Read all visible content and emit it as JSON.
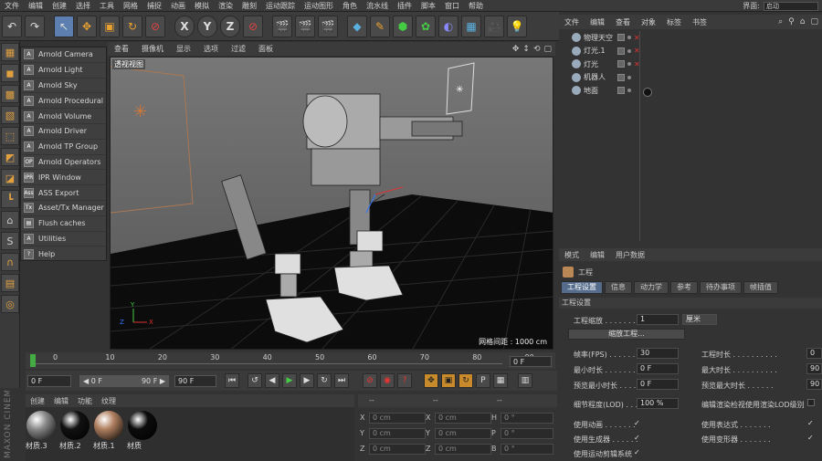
{
  "menu": [
    "文件",
    "编辑",
    "创建",
    "选择",
    "工具",
    "网格",
    "捕捉",
    "动画",
    "模拟",
    "渲染",
    "雕刻",
    "运动跟踪",
    "运动图形",
    "角色",
    "流水线",
    "插件",
    "脚本",
    "窗口",
    "帮助"
  ],
  "layout": {
    "label": "界面:",
    "value": "启动"
  },
  "toolbar": {
    "undo": "↶",
    "redo": "↷",
    "axis_x": "X",
    "axis_y": "Y",
    "axis_z": "Z"
  },
  "arnold_menu": [
    {
      "icon": "A",
      "label": "Arnold Camera"
    },
    {
      "icon": "A",
      "label": "Arnold Light"
    },
    {
      "icon": "A",
      "label": "Arnold Sky"
    },
    {
      "icon": "A",
      "label": "Arnold Procedural"
    },
    {
      "icon": "A",
      "label": "Arnold Volume"
    },
    {
      "icon": "A",
      "label": "Arnold Driver"
    },
    {
      "icon": "A",
      "label": "Arnold TP Group"
    },
    {
      "icon": "OP",
      "label": "Arnold Operators"
    },
    {
      "icon": "IPR",
      "label": "IPR Window"
    },
    {
      "icon": "Ass",
      "label": "ASS Export"
    },
    {
      "icon": "Tx",
      "label": "Asset/Tx Manager"
    },
    {
      "icon": "▤",
      "label": "Flush caches"
    },
    {
      "icon": "A",
      "label": "Utilities"
    },
    {
      "icon": "?",
      "label": "Help"
    }
  ],
  "viewport": {
    "menu": [
      "查看",
      "摄像机",
      "显示",
      "选项",
      "过滤",
      "面板"
    ],
    "label": "透视视图",
    "grid_spacing": "网格间距 : 1000 cm"
  },
  "objects": {
    "menu": [
      "文件",
      "编辑",
      "查看",
      "对象",
      "标签",
      "书签"
    ],
    "items": [
      {
        "name": "物理天空",
        "flag_x": true
      },
      {
        "name": "灯光.1",
        "flag_x": true
      },
      {
        "name": "灯光",
        "flag_x": true
      },
      {
        "name": "机器人",
        "flag_x": false
      },
      {
        "name": "地面",
        "flag_x": false
      }
    ]
  },
  "attributes": {
    "menu": [
      "模式",
      "编辑",
      "用户数据"
    ],
    "title": "工程",
    "tabs": [
      "工程设置",
      "信息",
      "动力学",
      "参考",
      "待办事项",
      "帧插值"
    ],
    "section": "工程设置",
    "scale_label": "工程缩放 . . . . . . . .",
    "scale_value": "1",
    "scale_unit": "厘米",
    "scale_button": "缩放工程...",
    "fps_label": "帧率(FPS) . . . . . . .",
    "fps_value": "30",
    "min_time_label": "最小时长 . . . . . . . .",
    "min_time_value": "0 F",
    "preview_min_label": "预览最小时长 . . . .",
    "preview_min_value": "0 F",
    "lod_label": "细节程度(LOD) . . . .",
    "lod_value": "100 %",
    "proj_time_label": "工程时长 . . . . . . . . . .",
    "proj_time_value": "0",
    "max_time_label": "最大时长 . . . . . . . . . .",
    "max_time_value": "90",
    "preview_max_label": "预览最大时长 . . . . . .",
    "preview_max_value": "90",
    "render_lod_label": "编辑渲染检视使用渲染LOD级别",
    "use_anim": "使用动画 . . . . . . .",
    "use_gen": "使用生成器 . . . . . .",
    "use_motion": "使用运动剪辑系统",
    "use_expr": "使用表达式 . . . . . . .",
    "use_deform": "使用变形器 . . . . . . .",
    "check": "✓"
  },
  "timeline": {
    "ticks": [
      "0",
      "10",
      "20",
      "30",
      "40",
      "50",
      "60",
      "70",
      "80",
      "90"
    ],
    "current_frame": 0,
    "end_field": "0 F"
  },
  "transport": {
    "start": "0 F",
    "range_start": "◀ 0 F",
    "range_end": "90 F ▶",
    "end": "90 F"
  },
  "materials": {
    "menu": [
      "创建",
      "编辑",
      "功能",
      "纹理"
    ],
    "items": [
      {
        "label": "材质.3",
        "color": "#8a8a8a"
      },
      {
        "label": "材质.2",
        "color": "#111111"
      },
      {
        "label": "材质.1",
        "color": "#b08060"
      },
      {
        "label": "材质",
        "color": "#0c0c0c"
      }
    ]
  },
  "coords": {
    "header": [
      "--",
      "--",
      "--"
    ],
    "rows": [
      {
        "a": "X",
        "av": "0 cm",
        "b": "X",
        "bv": "0 cm",
        "c": "H",
        "cv": "0 °"
      },
      {
        "a": "Y",
        "av": "0 cm",
        "b": "Y",
        "bv": "0 cm",
        "c": "P",
        "cv": "0 °"
      },
      {
        "a": "Z",
        "av": "0 cm",
        "b": "Z",
        "bv": "0 cm",
        "c": "B",
        "cv": "0 °"
      }
    ]
  },
  "brand": "MAXON CINEMA 4D"
}
